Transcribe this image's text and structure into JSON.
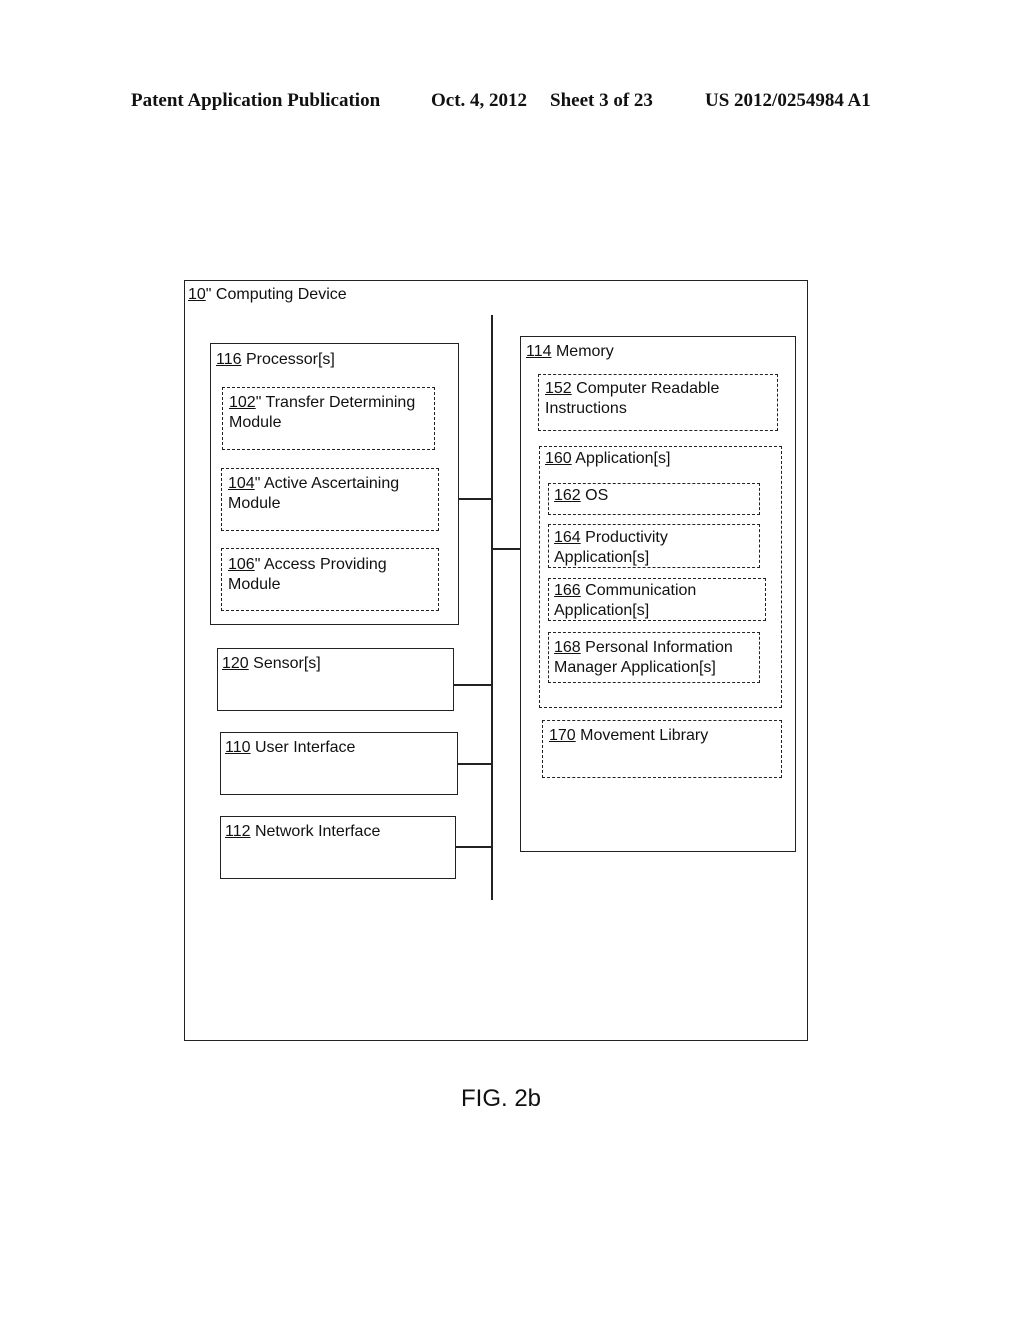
{
  "header": {
    "publication": "Patent Application Publication",
    "date": "Oct. 4, 2012",
    "sheet": "Sheet 3 of 23",
    "patent_number": "US 2012/0254984 A1"
  },
  "diagram": {
    "computing_device": {
      "ref": "10",
      "suffix": "\"",
      "label": " Computing Device"
    },
    "processor": {
      "ref": "116",
      "label": "  Processor[s]",
      "modules": [
        {
          "ref": "102",
          "line1": "\"  Transfer Determining",
          "line2": "Module"
        },
        {
          "ref": "104",
          "line1": "\"  Active Ascertaining",
          "line2": "Module"
        },
        {
          "ref": "106",
          "line1": "\" Access Providing",
          "line2": "Module"
        }
      ]
    },
    "sensor": {
      "ref": "120",
      "label": "  Sensor[s]"
    },
    "user_interface": {
      "ref": "110",
      "label": "  User Interface"
    },
    "network_interface": {
      "ref": "112",
      "label": "  Network Interface"
    },
    "memory": {
      "ref": "114",
      "label": "  Memory",
      "instructions": {
        "ref": "152",
        "line1": "  Computer Readable",
        "line2": "Instructions"
      },
      "applications": {
        "ref": "160",
        "label": " Application[s]",
        "items": [
          {
            "ref": "162",
            "line1": " OS",
            "line2": ""
          },
          {
            "ref": "164",
            "line1": " Productivity",
            "line2": "Application[s]"
          },
          {
            "ref": "166",
            "line1": " Communication",
            "line2": "Application[s]"
          },
          {
            "ref": "168",
            "line1": " Personal Information",
            "line2": "Manager Application[s]"
          }
        ]
      },
      "movement_library": {
        "ref": "170",
        "label": " Movement Library"
      }
    },
    "figure_label": "FIG. 2b"
  }
}
